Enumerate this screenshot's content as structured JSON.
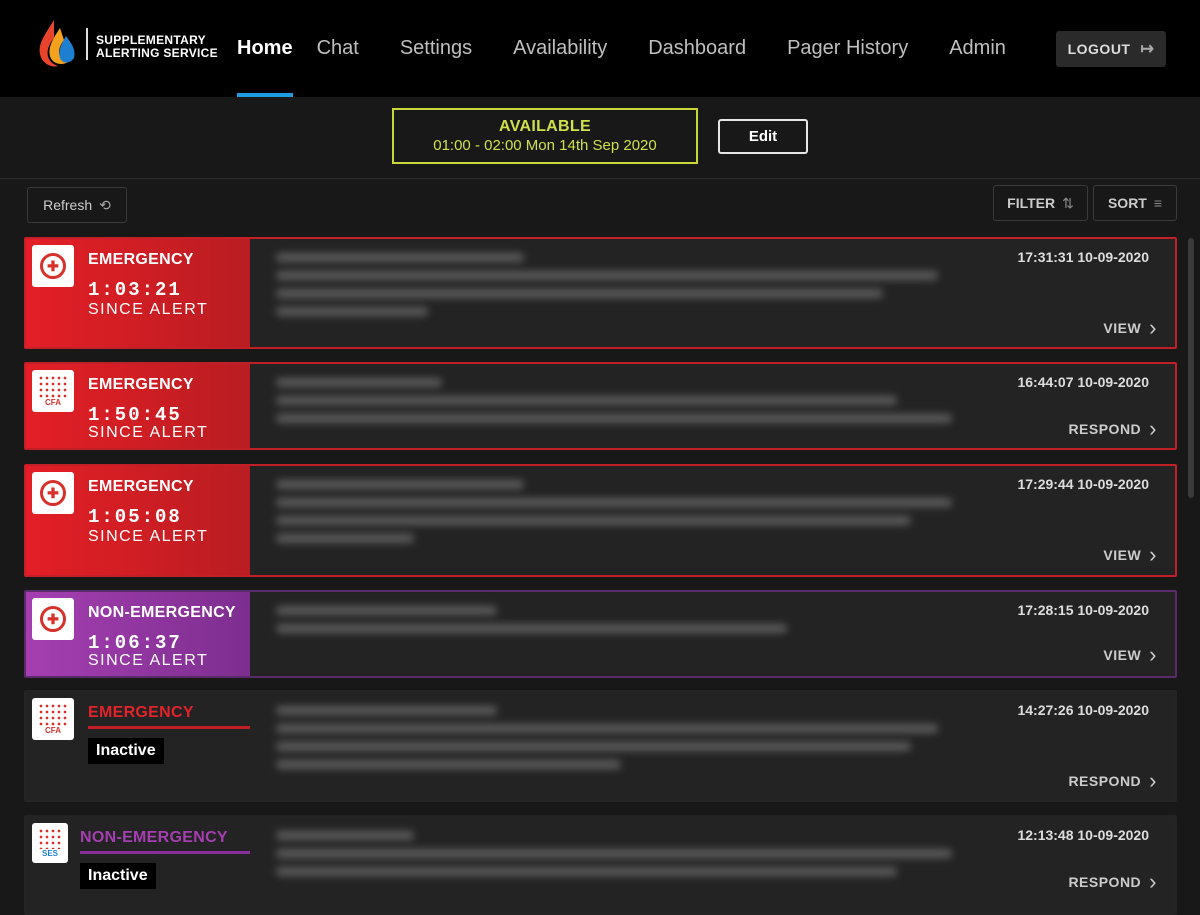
{
  "header": {
    "logo_line1": "SUPPLEMENTARY",
    "logo_line2": "ALERTING SERVICE",
    "nav": [
      {
        "label": "Home",
        "active": true
      },
      {
        "label": "Chat"
      },
      {
        "label": "Settings"
      },
      {
        "label": "Availability"
      },
      {
        "label": "Dashboard"
      },
      {
        "label": "Pager History"
      },
      {
        "label": "Admin"
      }
    ],
    "logout_label": "LOGOUT"
  },
  "availability": {
    "status": "AVAILABLE",
    "time": "01:00 - 02:00 Mon 14th Sep 2020",
    "edit_label": "Edit"
  },
  "toolbar": {
    "refresh_label": "Refresh",
    "filter_label": "FILTER",
    "sort_label": "SORT"
  },
  "colors": {
    "accent": "#1e9ce0",
    "available": "#cfe04a",
    "emergency": "#e41e26",
    "non_emergency": "#a53fb1"
  },
  "alerts": [
    {
      "type": "EMERGENCY",
      "timer": "1:03:21",
      "since": "SINCE ALERT",
      "datetime": "17:31:31 10-09-2020",
      "action": "VIEW",
      "icon": "ambulance-badge-icon"
    },
    {
      "type": "EMERGENCY",
      "timer": "1:50:45",
      "since": "SINCE ALERT",
      "datetime": "16:44:07 10-09-2020",
      "action": "RESPOND",
      "icon": "cfa-badge-icon"
    },
    {
      "type": "EMERGENCY",
      "timer": "1:05:08",
      "since": "SINCE ALERT",
      "datetime": "17:29:44 10-09-2020",
      "action": "VIEW",
      "icon": "ambulance-badge-icon"
    },
    {
      "type": "NON-EMERGENCY",
      "timer": "1:06:37",
      "since": "SINCE ALERT",
      "datetime": "17:28:15 10-09-2020",
      "action": "VIEW",
      "icon": "ambulance-badge-icon"
    },
    {
      "type": "EMERGENCY",
      "status": "Inactive",
      "datetime": "14:27:26 10-09-2020",
      "action": "RESPOND",
      "icon": "cfa-badge-icon"
    },
    {
      "type": "NON-EMERGENCY",
      "status": "Inactive",
      "datetime": "12:13:48 10-09-2020",
      "action": "RESPOND",
      "icon": "ses-badge-icon"
    }
  ]
}
